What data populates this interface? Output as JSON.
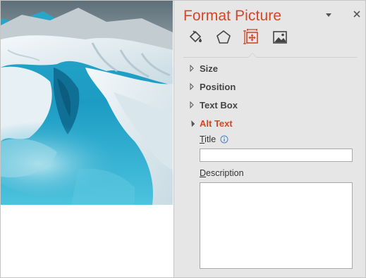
{
  "pane": {
    "title": "Format Picture",
    "tabs": [
      {
        "name": "Fill & Line",
        "icon": "paint-bucket-icon"
      },
      {
        "name": "Effects",
        "icon": "pentagon-icon"
      },
      {
        "name": "Size & Properties",
        "icon": "size-properties-icon",
        "active": true
      },
      {
        "name": "Picture",
        "icon": "picture-icon"
      }
    ],
    "sections": {
      "size": "Size",
      "position": "Position",
      "text_box": "Text Box",
      "alt_text": "Alt Text"
    },
    "alt_text": {
      "title_label_first": "T",
      "title_label_rest": "itle",
      "title_value": "",
      "description_label_first": "D",
      "description_label_rest": "escription",
      "description_value": ""
    }
  },
  "colors": {
    "accent": "#d24726",
    "pane_bg": "#e6e6e6"
  }
}
